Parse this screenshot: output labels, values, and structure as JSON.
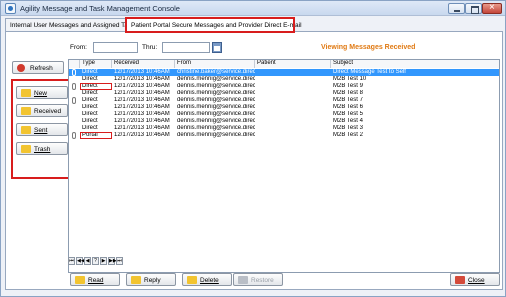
{
  "window": {
    "title": "Agility Message and Task Management Console"
  },
  "tabs": [
    {
      "label": "Internal User Messages and Assigned Tasks"
    },
    {
      "label": "Patient Portal Secure Messages and Provider Direct E-mail"
    }
  ],
  "toolbar": {
    "refresh_label": "Refresh",
    "from_label": "From:",
    "thru_label": "Thru:",
    "from_value": "",
    "thru_value": "",
    "status": "Viewing Messages Received"
  },
  "nav": {
    "new": "New",
    "received": "Received",
    "sent": "Sent",
    "trash": "Trash"
  },
  "grid": {
    "columns": [
      "Type",
      "Received",
      "From",
      "Patient",
      "Subject"
    ],
    "rows": [
      {
        "type": "Direct",
        "received": "12/17/2013 10:46AM",
        "from": "christine.baker@service.direc",
        "patient": "",
        "subject": "Direct Message Test to Self",
        "attachment": true
      },
      {
        "type": "Direct",
        "received": "12/17/2013 10:46AM",
        "from": "dennis.mennig@service.direc",
        "patient": "",
        "subject": "M2B Test 10",
        "attachment": false
      },
      {
        "type": "Direct",
        "received": "12/17/2013 10:46AM",
        "from": "dennis.mennig@service.direc",
        "patient": "",
        "subject": "M2B Test 9",
        "attachment": true
      },
      {
        "type": "Direct",
        "received": "12/17/2013 10:46AM",
        "from": "dennis.mennig@service.direc",
        "patient": "",
        "subject": "M2B Test 8",
        "attachment": false
      },
      {
        "type": "Direct",
        "received": "12/17/2013 10:46AM",
        "from": "dennis.mennig@service.direc",
        "patient": "",
        "subject": "M2B Test 7",
        "attachment": true
      },
      {
        "type": "Direct",
        "received": "12/17/2013 10:46AM",
        "from": "dennis.mennig@service.direc",
        "patient": "",
        "subject": "M2B Test 6",
        "attachment": false
      },
      {
        "type": "Direct",
        "received": "12/17/2013 10:46AM",
        "from": "dennis.mennig@service.direc",
        "patient": "",
        "subject": "M2B Test 5",
        "attachment": false
      },
      {
        "type": "Direct",
        "received": "12/17/2013 10:46AM",
        "from": "dennis.mennig@service.direc",
        "patient": "",
        "subject": "M2B Test 4",
        "attachment": false
      },
      {
        "type": "Direct",
        "received": "12/17/2013 10:46AM",
        "from": "dennis.mennig@service.direc",
        "patient": "",
        "subject": "M2B Test 3",
        "attachment": false
      },
      {
        "type": "Portal",
        "received": "12/17/2013 10:46AM",
        "from": "dennis.mennig@service.direc",
        "patient": "",
        "subject": "M2B Test 2",
        "attachment": true
      }
    ]
  },
  "pager": [
    "⏮",
    "◀◀",
    "◀",
    "?",
    "▶",
    "▶▶",
    "⏭"
  ],
  "actions": {
    "read": "Read",
    "reply": "Reply",
    "delete": "Delete",
    "restore": "Restore",
    "close": "Close"
  }
}
